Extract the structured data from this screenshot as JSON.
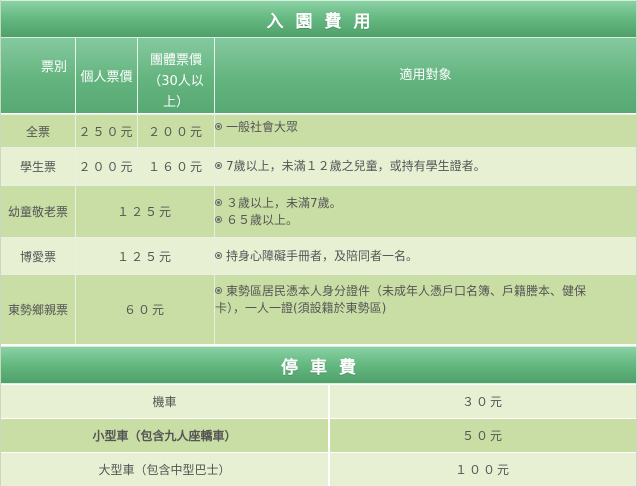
{
  "admission": {
    "title": "入園費用",
    "headers": {
      "ticket_type": "票別",
      "individual_price": "個人票價",
      "group_price_line1": "團體票價",
      "group_price_line2": "（30人以",
      "group_price_line3": "上）",
      "applicable": "適用對象"
    },
    "rows": [
      {
        "name": "全票",
        "individual": "２５０元",
        "group": "２００元",
        "desc": [
          "一般社會大眾"
        ]
      },
      {
        "name": "學生票",
        "individual": "２００元",
        "group": "１６０元",
        "desc": [
          "7歲以上，未滿１２歲之兒童，或持有學生證者。"
        ]
      },
      {
        "name": "幼童敬老票",
        "price": "１２５元",
        "desc": [
          "３歲以上，未滿7歲。",
          "６５歲以上。"
        ]
      },
      {
        "name": "博愛票",
        "price": "１２５元",
        "desc": [
          "持身心障礙手冊者，及陪同者一名。"
        ]
      },
      {
        "name": "東勢鄉親票",
        "price": "６０元",
        "desc_line1": "東勢區居民憑本人身分證件（未成年人憑戶口名簿、戶籍謄本、健保",
        "desc_line2": "卡），一人一證(須設籍於東勢區)"
      }
    ]
  },
  "parking": {
    "title": "停車費",
    "rows": [
      {
        "vehicle": "機車",
        "fee": "３０元",
        "bold": false
      },
      {
        "vehicle": "小型車（包含九人座轎車）",
        "fee": "５０元",
        "bold": true
      },
      {
        "vehicle": "大型車（包含中型巴士）",
        "fee": "１００元",
        "bold": false
      }
    ]
  },
  "icons": {
    "bullet": "circle-bullet-icon"
  },
  "colors": {
    "banner_green": "#67ba83",
    "row_dark": "#c9dea5",
    "row_light": "#e7f0d3",
    "text": "#555555"
  }
}
